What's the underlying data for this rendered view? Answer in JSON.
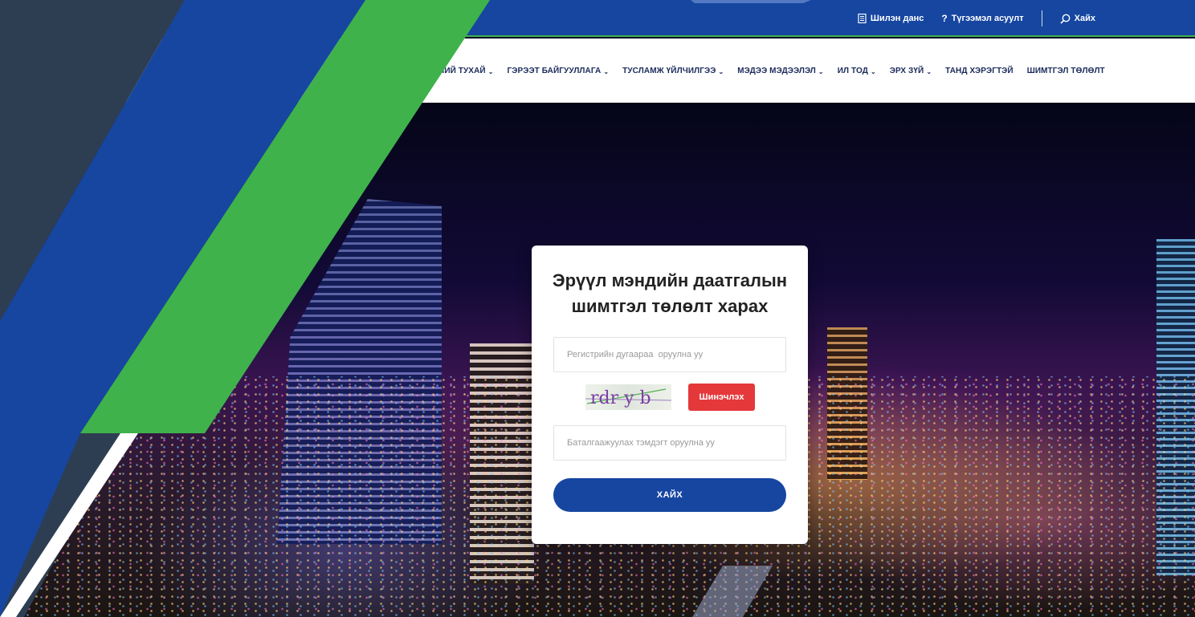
{
  "topbar": {
    "links": [
      {
        "label": "Шилэн данс",
        "icon": "document-icon"
      },
      {
        "label": "Түгээмэл асуулт",
        "icon": "question-icon"
      },
      {
        "label": "Хайх",
        "icon": "search-icon"
      }
    ]
  },
  "nav": {
    "items": [
      {
        "label": "НИЙ ТУХАЙ",
        "has_dropdown": true
      },
      {
        "label": "ГЭРЭЭТ БАЙГУУЛЛАГА",
        "has_dropdown": true
      },
      {
        "label": "ТУСЛАМЖ ҮЙЛЧИЛГЭЭ",
        "has_dropdown": true
      },
      {
        "label": "МЭДЭЭ МЭДЭЭЛЭЛ",
        "has_dropdown": true
      },
      {
        "label": "ИЛ ТОД",
        "has_dropdown": true
      },
      {
        "label": "ЭРХ ЗҮЙ",
        "has_dropdown": true
      },
      {
        "label": "ТАНД ХЭРЭГТЭЙ",
        "has_dropdown": false
      },
      {
        "label": "ШИМТГЭЛ ТӨЛӨЛТ",
        "has_dropdown": false
      }
    ]
  },
  "form": {
    "title_line1": "Эрүүл мэндийн даатгалын",
    "title_line2": "шимтгэл төлөлт харах",
    "register_placeholder": "Регистрийн дугаараа  оруулна уу",
    "captcha_text": "rdr y b",
    "refresh_label": "Шинэчлэх",
    "code_placeholder": "Баталгаажуулах тэмдэгт оруулна уу",
    "search_label": "ХАЙХ"
  },
  "colors": {
    "brand_blue": "#1646a0",
    "brand_green": "#3fb24c",
    "dark_slate": "#2e3e52",
    "refresh_red": "#e5383b"
  }
}
